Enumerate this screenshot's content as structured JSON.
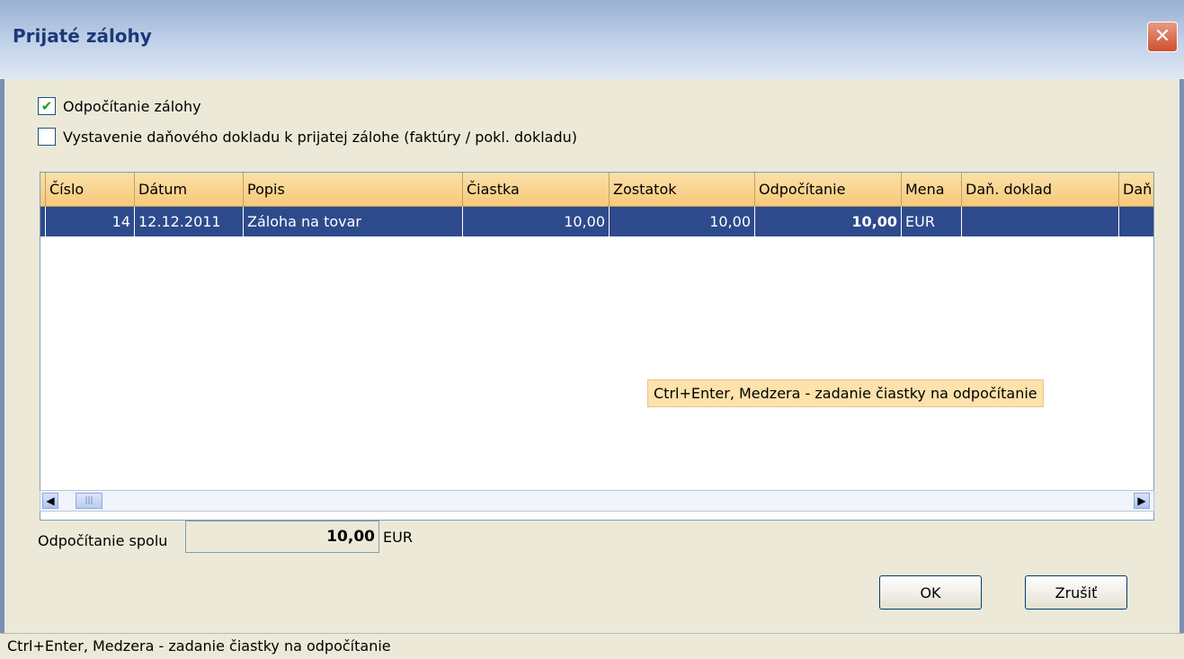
{
  "window": {
    "title": "Prijaté zálohy"
  },
  "options": {
    "deduct": {
      "label": "Odpočítanie zálohy",
      "checked": true
    },
    "tax_doc": {
      "label": "Vystavenie daňového dokladu k prijatej zálohe (faktúry / pokl. dokladu)",
      "checked": false
    }
  },
  "grid": {
    "columns": [
      "Číslo",
      "Dátum",
      "Popis",
      "Čiastka",
      "Zostatok",
      "Odpočítanie",
      "Mena",
      "Daň. doklad",
      "Daň"
    ],
    "rows": [
      {
        "cislo": "14",
        "datum": "12.12.2011",
        "popis": "Záloha na tovar",
        "ciastka": "10,00",
        "zostatok": "10,00",
        "odpocitanie": "10,00",
        "mena": "EUR",
        "dan_doklad": "",
        "dan": ""
      }
    ]
  },
  "hint": "Ctrl+Enter, Medzera - zadanie čiastky na odpočítanie",
  "total": {
    "label": "Odpočítanie spolu",
    "value": "10,00",
    "currency": "EUR"
  },
  "buttons": {
    "ok": "OK",
    "cancel": "Zrušiť"
  },
  "status": "Ctrl+Enter, Medzera - zadanie čiastky na odpočítanie"
}
